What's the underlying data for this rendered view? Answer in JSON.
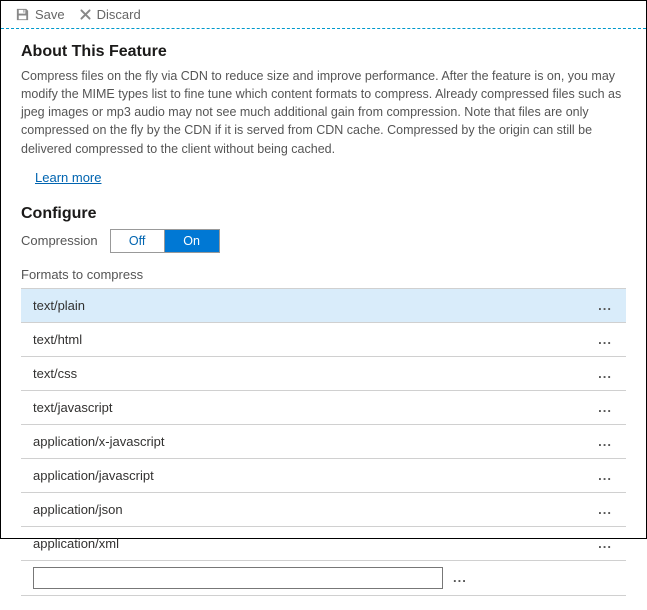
{
  "toolbar": {
    "save_label": "Save",
    "discard_label": "Discard"
  },
  "about": {
    "title": "About This Feature",
    "description": "Compress files on the fly via CDN to reduce size and improve performance. After the feature is on, you may modify the MIME types list to fine tune which content formats to compress. Already compressed files such as jpeg images or mp3 audio may not see much additional gain from compression. Note that files are only compressed on the fly by the CDN if it is served from CDN cache. Compressed by the origin can still be delivered compressed to the client without being cached.",
    "learn_more": "Learn more"
  },
  "configure": {
    "title": "Configure",
    "compression_label": "Compression",
    "toggle_off": "Off",
    "toggle_on": "On",
    "toggle_state": "On",
    "formats_label": "Formats to compress",
    "formats": [
      {
        "name": "text/plain",
        "selected": true
      },
      {
        "name": "text/html",
        "selected": false
      },
      {
        "name": "text/css",
        "selected": false
      },
      {
        "name": "text/javascript",
        "selected": false
      },
      {
        "name": "application/x-javascript",
        "selected": false
      },
      {
        "name": "application/javascript",
        "selected": false
      },
      {
        "name": "application/json",
        "selected": false
      },
      {
        "name": "application/xml",
        "selected": false
      }
    ],
    "more_glyph": "...",
    "new_format_value": ""
  }
}
